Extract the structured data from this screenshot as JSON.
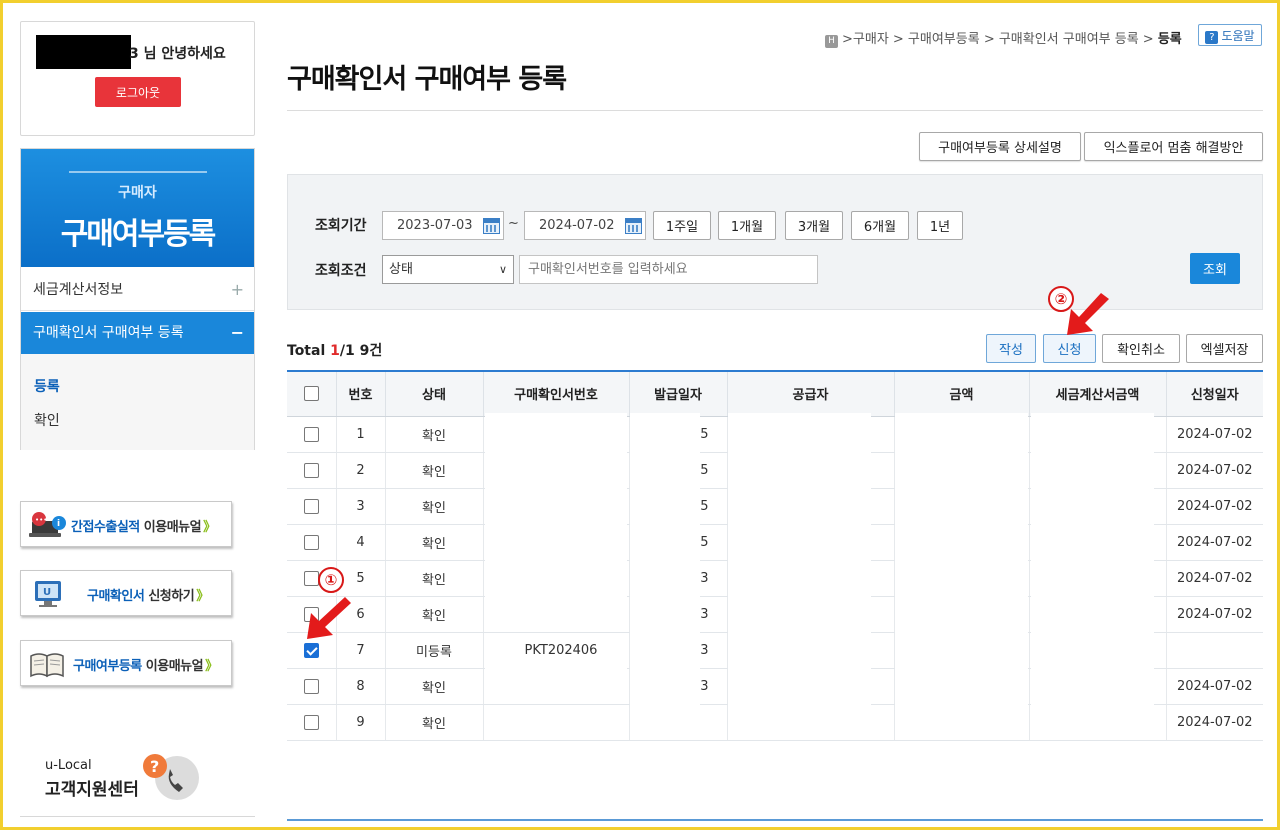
{
  "login": {
    "greeting": "3 님 안녕하세요",
    "logout": "로그아웃"
  },
  "side": {
    "sub": "구매자",
    "title": "구매여부등록",
    "items": [
      {
        "label": "세금계산서정보",
        "toggle": "+"
      },
      {
        "label": "구매확인서 구매여부 등록",
        "toggle": "−"
      }
    ],
    "sub_items": [
      "등록",
      "확인"
    ]
  },
  "banners": [
    {
      "blue": "간접수출실적",
      "rest": " 이용매뉴얼",
      "chev": "》"
    },
    {
      "blue": "구매확인서",
      "rest": " 신청하기",
      "chev": "》"
    },
    {
      "blue": "구매여부등록",
      "rest": " 이용매뉴얼",
      "chev": "》"
    }
  ],
  "support": {
    "line1": "u-Local",
    "line2": "고객지원센터"
  },
  "breadcrumb": {
    "icon": "H",
    "path": ">구매자 > 구매여부등록 > 구매확인서 구매여부 등록 > ",
    "current": "등록"
  },
  "help": "도움말",
  "page_title": "구매확인서 구매여부 등록",
  "top_buttons": {
    "desc": "구매여부등록 상세설명",
    "ie": "익스플로어 멈춤 해결방안"
  },
  "search": {
    "period_label": "조회기간",
    "date_from": "2023-07-03",
    "tilde": "~",
    "date_to": "2024-07-02",
    "periods": [
      "1주일",
      "1개월",
      "3개월",
      "6개월",
      "1년"
    ],
    "cond_label": "조회조건",
    "cond_select": "상태",
    "cond_placeholder": "구매확인서번호를 입력하세요",
    "search_button": "조회"
  },
  "total": {
    "prefix": "Total ",
    "page": "1",
    "suffix": "/1 9건"
  },
  "actions": {
    "write": "작성",
    "apply": "신청",
    "cancel": "확인취소",
    "excel": "엑셀저장"
  },
  "table": {
    "headers": [
      "번호",
      "상태",
      "구매확인서번호",
      "발급일자",
      "공급자",
      "금액",
      "세금계산서금액",
      "신청일자"
    ],
    "rows": [
      {
        "no": "1",
        "status": "확인",
        "doc": "",
        "issue": "5",
        "date": "2024-07-02",
        "checked": false
      },
      {
        "no": "2",
        "status": "확인",
        "doc": "",
        "issue": "5",
        "date": "2024-07-02",
        "checked": false
      },
      {
        "no": "3",
        "status": "확인",
        "doc": "",
        "issue": "5",
        "date": "2024-07-02",
        "checked": false
      },
      {
        "no": "4",
        "status": "확인",
        "doc": "",
        "issue": "5",
        "date": "2024-07-02",
        "checked": false
      },
      {
        "no": "5",
        "status": "확인",
        "doc": "",
        "issue": "3",
        "date": "2024-07-02",
        "checked": false
      },
      {
        "no": "6",
        "status": "확인",
        "doc": "",
        "issue": "3",
        "date": "2024-07-02",
        "checked": false
      },
      {
        "no": "7",
        "status": "미등록",
        "doc": "PKT202406",
        "issue": "3",
        "date": "",
        "checked": true
      },
      {
        "no": "8",
        "status": "확인",
        "doc": "",
        "issue": "3",
        "date": "2024-07-02",
        "checked": false
      },
      {
        "no": "9",
        "status": "확인",
        "doc": "",
        "issue": "",
        "date": "2024-07-02",
        "checked": false
      }
    ]
  },
  "markers": [
    "①",
    "②"
  ],
  "colors": {
    "accent": "#1a87da",
    "logout": "#e8343a",
    "annotation": "#d81818",
    "frame": "#f2cf2e"
  }
}
